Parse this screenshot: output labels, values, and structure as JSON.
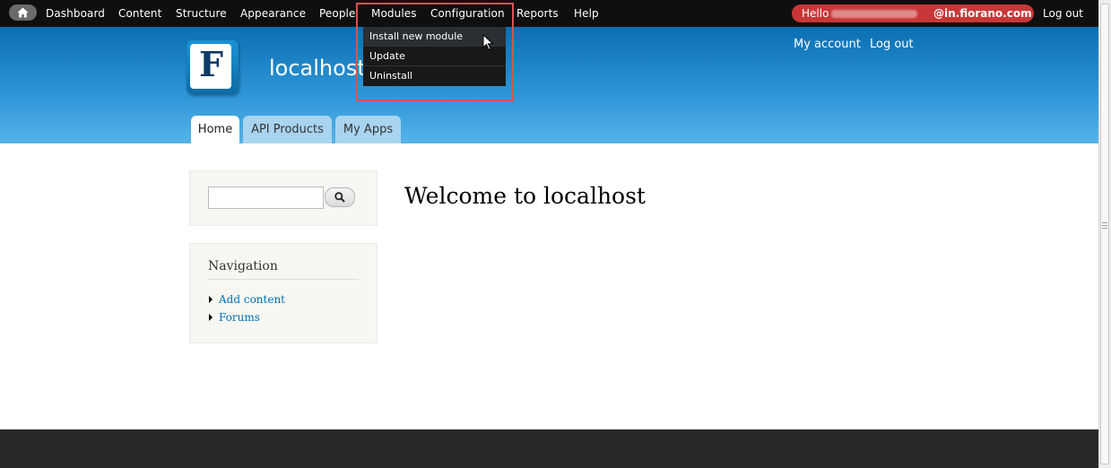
{
  "toolbar": {
    "items": [
      {
        "label": "Dashboard"
      },
      {
        "label": "Content"
      },
      {
        "label": "Structure"
      },
      {
        "label": "Appearance"
      },
      {
        "label": "People"
      },
      {
        "label": "Modules"
      },
      {
        "label": "Configuration"
      },
      {
        "label": "Reports"
      },
      {
        "label": "Help"
      }
    ],
    "hello_label": "Hello",
    "user_domain": "@in.fiorano.com",
    "logout_label": "Log out"
  },
  "modules_menu": {
    "items": [
      {
        "label": "Install new module"
      },
      {
        "label": "Update"
      },
      {
        "label": "Uninstall"
      }
    ]
  },
  "header": {
    "logo_letter": "F",
    "site_name": "localhost",
    "secondary_links": [
      {
        "label": "My account"
      },
      {
        "label": "Log out"
      }
    ],
    "tabs": [
      {
        "label": "Home"
      },
      {
        "label": "API Products"
      },
      {
        "label": "My Apps"
      }
    ]
  },
  "sidebar": {
    "search": {
      "placeholder": ""
    },
    "navigation": {
      "title": "Navigation",
      "items": [
        {
          "label": "Add content"
        },
        {
          "label": "Forums"
        }
      ]
    }
  },
  "main": {
    "title": "Welcome to localhost"
  },
  "colors": {
    "toolbar_bg": "#0f0f0f",
    "header_blue": "#2f97d8",
    "hello_badge": "#c83737",
    "highlight_border": "#d9534f",
    "link_blue": "#0071b3",
    "footer_bg": "#292929"
  }
}
